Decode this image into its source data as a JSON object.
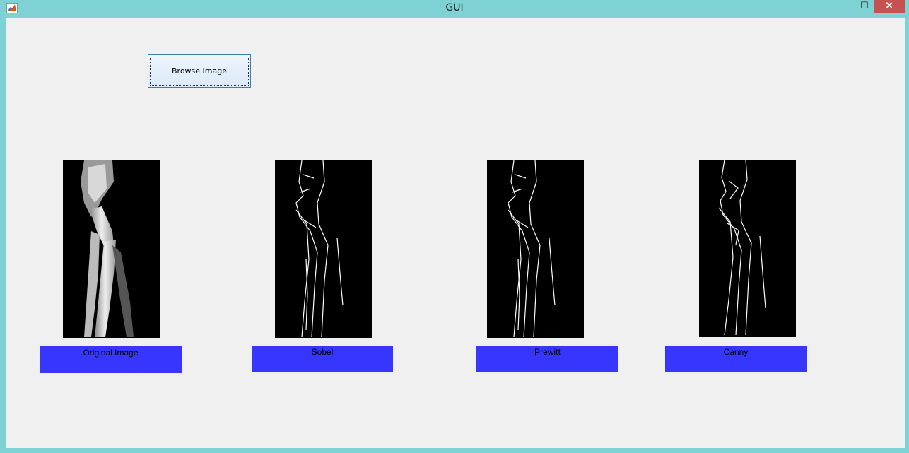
{
  "window": {
    "title": "GUI",
    "minimize_glyph": "–",
    "maximize_glyph": "☐",
    "close_glyph": "✕"
  },
  "toolbar": {
    "browse_label": "Browse Image"
  },
  "panels": [
    {
      "label": "Original Image",
      "icon": "xray-image"
    },
    {
      "label": "Sobel",
      "icon": "edge-map-image"
    },
    {
      "label": "Prewitt",
      "icon": "edge-map-image"
    },
    {
      "label": "Canny",
      "icon": "edge-map-image"
    }
  ],
  "colors": {
    "titlebar": "#7fd2d4",
    "label_bg": "#3636ff",
    "close": "#c75050",
    "client_bg": "#f0f0f0"
  }
}
